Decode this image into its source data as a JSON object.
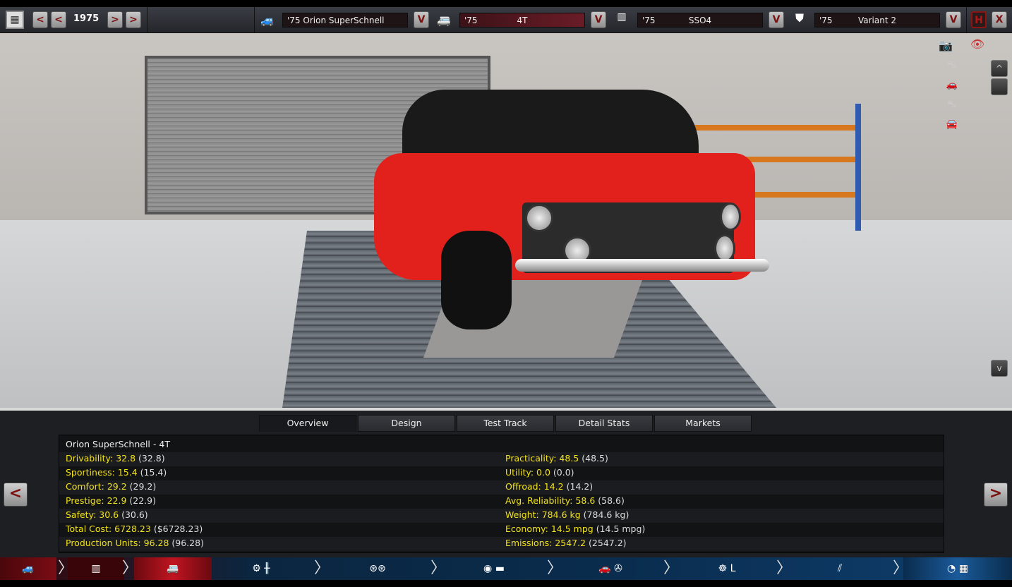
{
  "top_bar": {
    "year": "1975",
    "model": {
      "year": "'75",
      "name": "Orion SuperSchnell"
    },
    "trim": {
      "year": "'75",
      "name": "4T"
    },
    "engine": {
      "year": "'75",
      "name": "SSO4"
    },
    "engine_variant": {
      "year": "'75",
      "name": "Variant 2"
    },
    "dropdown_glyph": "V",
    "prev_glyph": "<",
    "next_glyph": ">",
    "save_glyph": "H",
    "close_glyph": "X"
  },
  "side_controls": {
    "up": "^",
    "down": "v"
  },
  "tabs": [
    {
      "label": "Overview",
      "active": true
    },
    {
      "label": "Design"
    },
    {
      "label": "Test Track"
    },
    {
      "label": "Detail Stats"
    },
    {
      "label": "Markets"
    }
  ],
  "overview": {
    "title": "Orion SuperSchnell - 4T",
    "left": [
      {
        "label": "Drivability: 32.8",
        "paren": "(32.8)"
      },
      {
        "label": "Sportiness: 15.4",
        "paren": "(15.4)"
      },
      {
        "label": "Comfort: 29.2",
        "paren": "(29.2)"
      },
      {
        "label": "Prestige: 22.9",
        "paren": "(22.9)"
      },
      {
        "label": "Safety: 30.6",
        "paren": "(30.6)"
      },
      {
        "label": "Total Cost: 6728.23",
        "paren": "($6728.23)"
      },
      {
        "label": "Production Units: 96.28",
        "paren": "(96.28)"
      }
    ],
    "right": [
      {
        "label": "Practicality: 48.5",
        "paren": "(48.5)"
      },
      {
        "label": "Utility: 0.0",
        "paren": "(0.0)"
      },
      {
        "label": "Offroad: 14.2",
        "paren": "(14.2)"
      },
      {
        "label": "Avg. Reliability: 58.6",
        "paren": "(58.6)"
      },
      {
        "label": "Weight: 784.6 kg",
        "paren": "(784.6 kg)"
      },
      {
        "label": "Economy: 14.5 mpg",
        "paren": "(14.5 mpg)"
      },
      {
        "label": "Emissions: 2547.2",
        "paren": "(2547.2)"
      }
    ]
  },
  "bottom_nav": {
    "steps": [
      "model",
      "trim",
      "body",
      "chassis-gearbox",
      "wheels",
      "brakes-interior",
      "aero-cooling",
      "steering-seats",
      "suspension",
      "test-drive"
    ],
    "active": "body"
  },
  "colors": {
    "accent_red": "#7a1010",
    "stat_label": "#f2e21a",
    "car": "#e3211c"
  }
}
